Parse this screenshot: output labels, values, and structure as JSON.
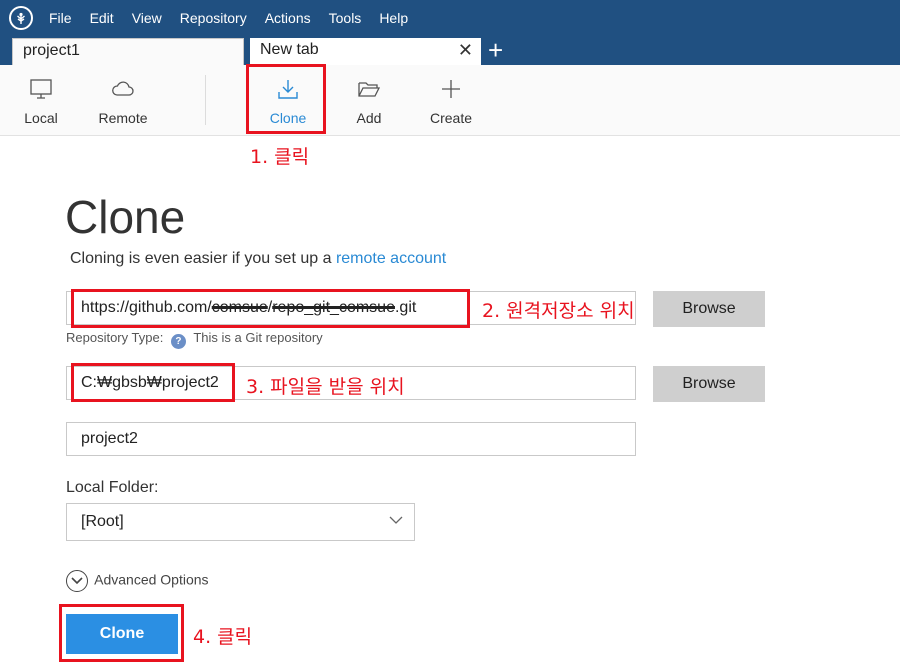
{
  "menu": [
    "File",
    "Edit",
    "View",
    "Repository",
    "Actions",
    "Tools",
    "Help"
  ],
  "tabs": [
    {
      "label": "project1"
    },
    {
      "label": "New tab",
      "close": "✕"
    }
  ],
  "tab_add": "+",
  "toolbar": {
    "local": "Local",
    "remote": "Remote",
    "clone": "Clone",
    "add": "Add",
    "create": "Create"
  },
  "clone_form": {
    "title": "Clone",
    "subtitle_prefix": "Cloning is even easier if you set up a",
    "subtitle_link": "remote account",
    "url_prefix": "https://github.com/",
    "url_user": "comsue",
    "url_slash": "/",
    "url_repo": "repo_git_comsue",
    "url_suffix": ".git",
    "browse_label": "Browse",
    "repo_type_label": "Repository Type:",
    "repo_type_help": "?",
    "repo_type_value": "This is a Git repository",
    "destination_path": "C:₩gbsb₩project2",
    "name": "project2",
    "local_folder_label": "Local Folder:",
    "local_folder_value": "[Root]",
    "advanced_options": "Advanced Options",
    "clone_button": "Clone"
  },
  "annotations": {
    "a1": "1. 클릭",
    "a2": "2. 원격저장소 위치",
    "a3": "3. 파일을 받을 위치",
    "a4": "4. 클릭"
  },
  "colors": {
    "titlebar": "#205081",
    "accent": "#2b8fe3",
    "link": "#2a8ad4",
    "annotation": "#e8131f"
  }
}
